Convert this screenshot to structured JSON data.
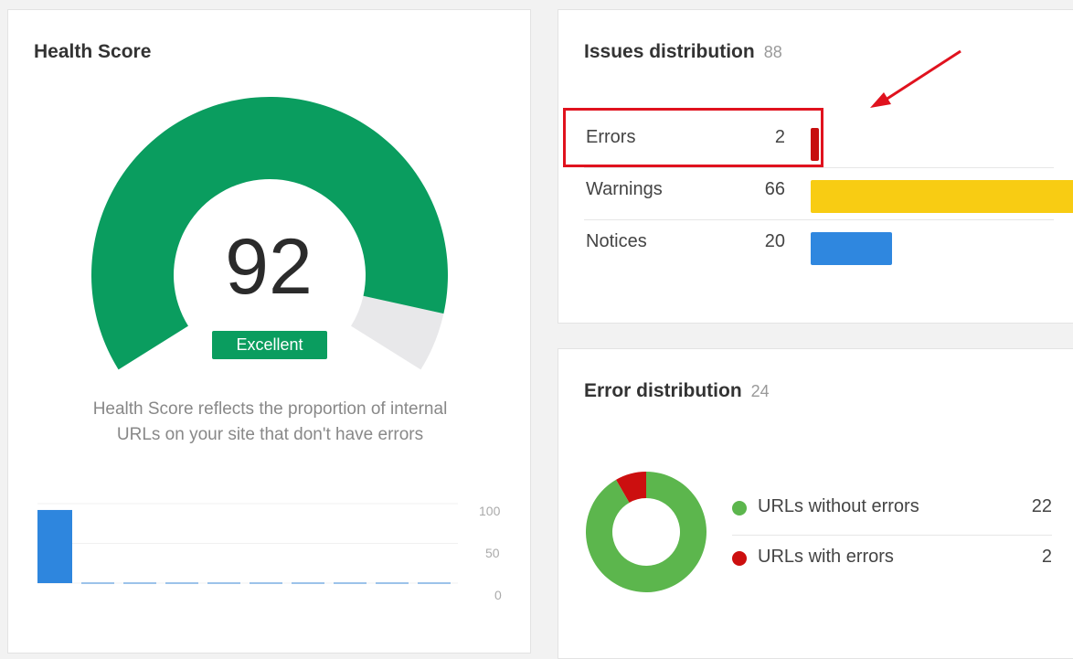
{
  "health": {
    "title": "Health Score",
    "score": "92",
    "score_fraction": 0.92,
    "rating": "Excellent",
    "description_line1": "Health Score reflects the proportion of internal",
    "description_line2": "URLs on your site that don't have errors",
    "colors": {
      "filled": "#0a9d5f",
      "empty": "#e8e8ea",
      "badge": "#0a9d5f"
    },
    "history_chart": {
      "type": "bar",
      "ylim": [
        0,
        100
      ],
      "y_ticks": [
        "100",
        "50",
        "0"
      ],
      "values": [
        92,
        0,
        0,
        0,
        0,
        0,
        0,
        0,
        0,
        0
      ],
      "bar_color": "#2e86de"
    }
  },
  "issues": {
    "title": "Issues distribution",
    "total": "88",
    "max_value": 66,
    "rows": [
      {
        "label": "Errors",
        "count": "2",
        "value": 2,
        "color": "#c70f0f"
      },
      {
        "label": "Warnings",
        "count": "66",
        "value": 66,
        "color": "#f8cc13"
      },
      {
        "label": "Notices",
        "count": "20",
        "value": 20,
        "color": "#2f87df"
      }
    ],
    "annotation_color": "#e0121e"
  },
  "error_distribution": {
    "title": "Error distribution",
    "total": "24",
    "items": [
      {
        "label": "URLs without errors",
        "value": "22",
        "amount": 22,
        "color": "#5cb64d"
      },
      {
        "label": "URLs with errors",
        "value": "2",
        "amount": 2,
        "color": "#cc0f0f"
      }
    ]
  }
}
